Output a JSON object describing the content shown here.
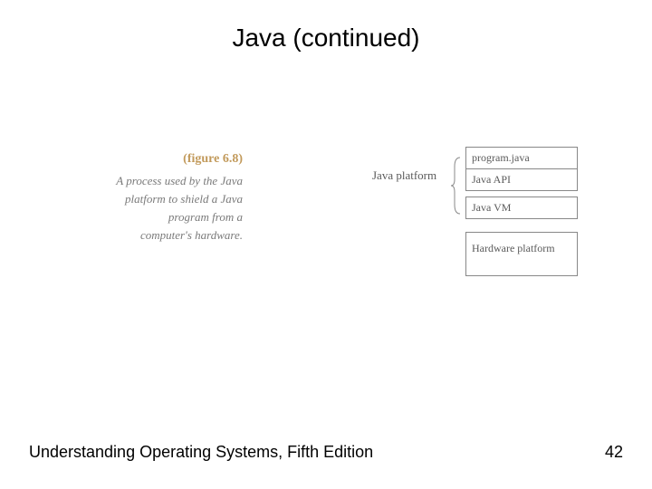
{
  "title": "Java (continued)",
  "figure": {
    "label": "(figure 6.8)",
    "description": "A process used by the Java platform to shield a Java program from a computer's hardware."
  },
  "platform_label": "Java platform",
  "diagram": {
    "program": "program.java",
    "api": "Java API",
    "vm": "Java VM",
    "hardware": "Hardware platform"
  },
  "footer": {
    "book": "Understanding Operating Systems, Fifth Edition",
    "page": "42"
  }
}
